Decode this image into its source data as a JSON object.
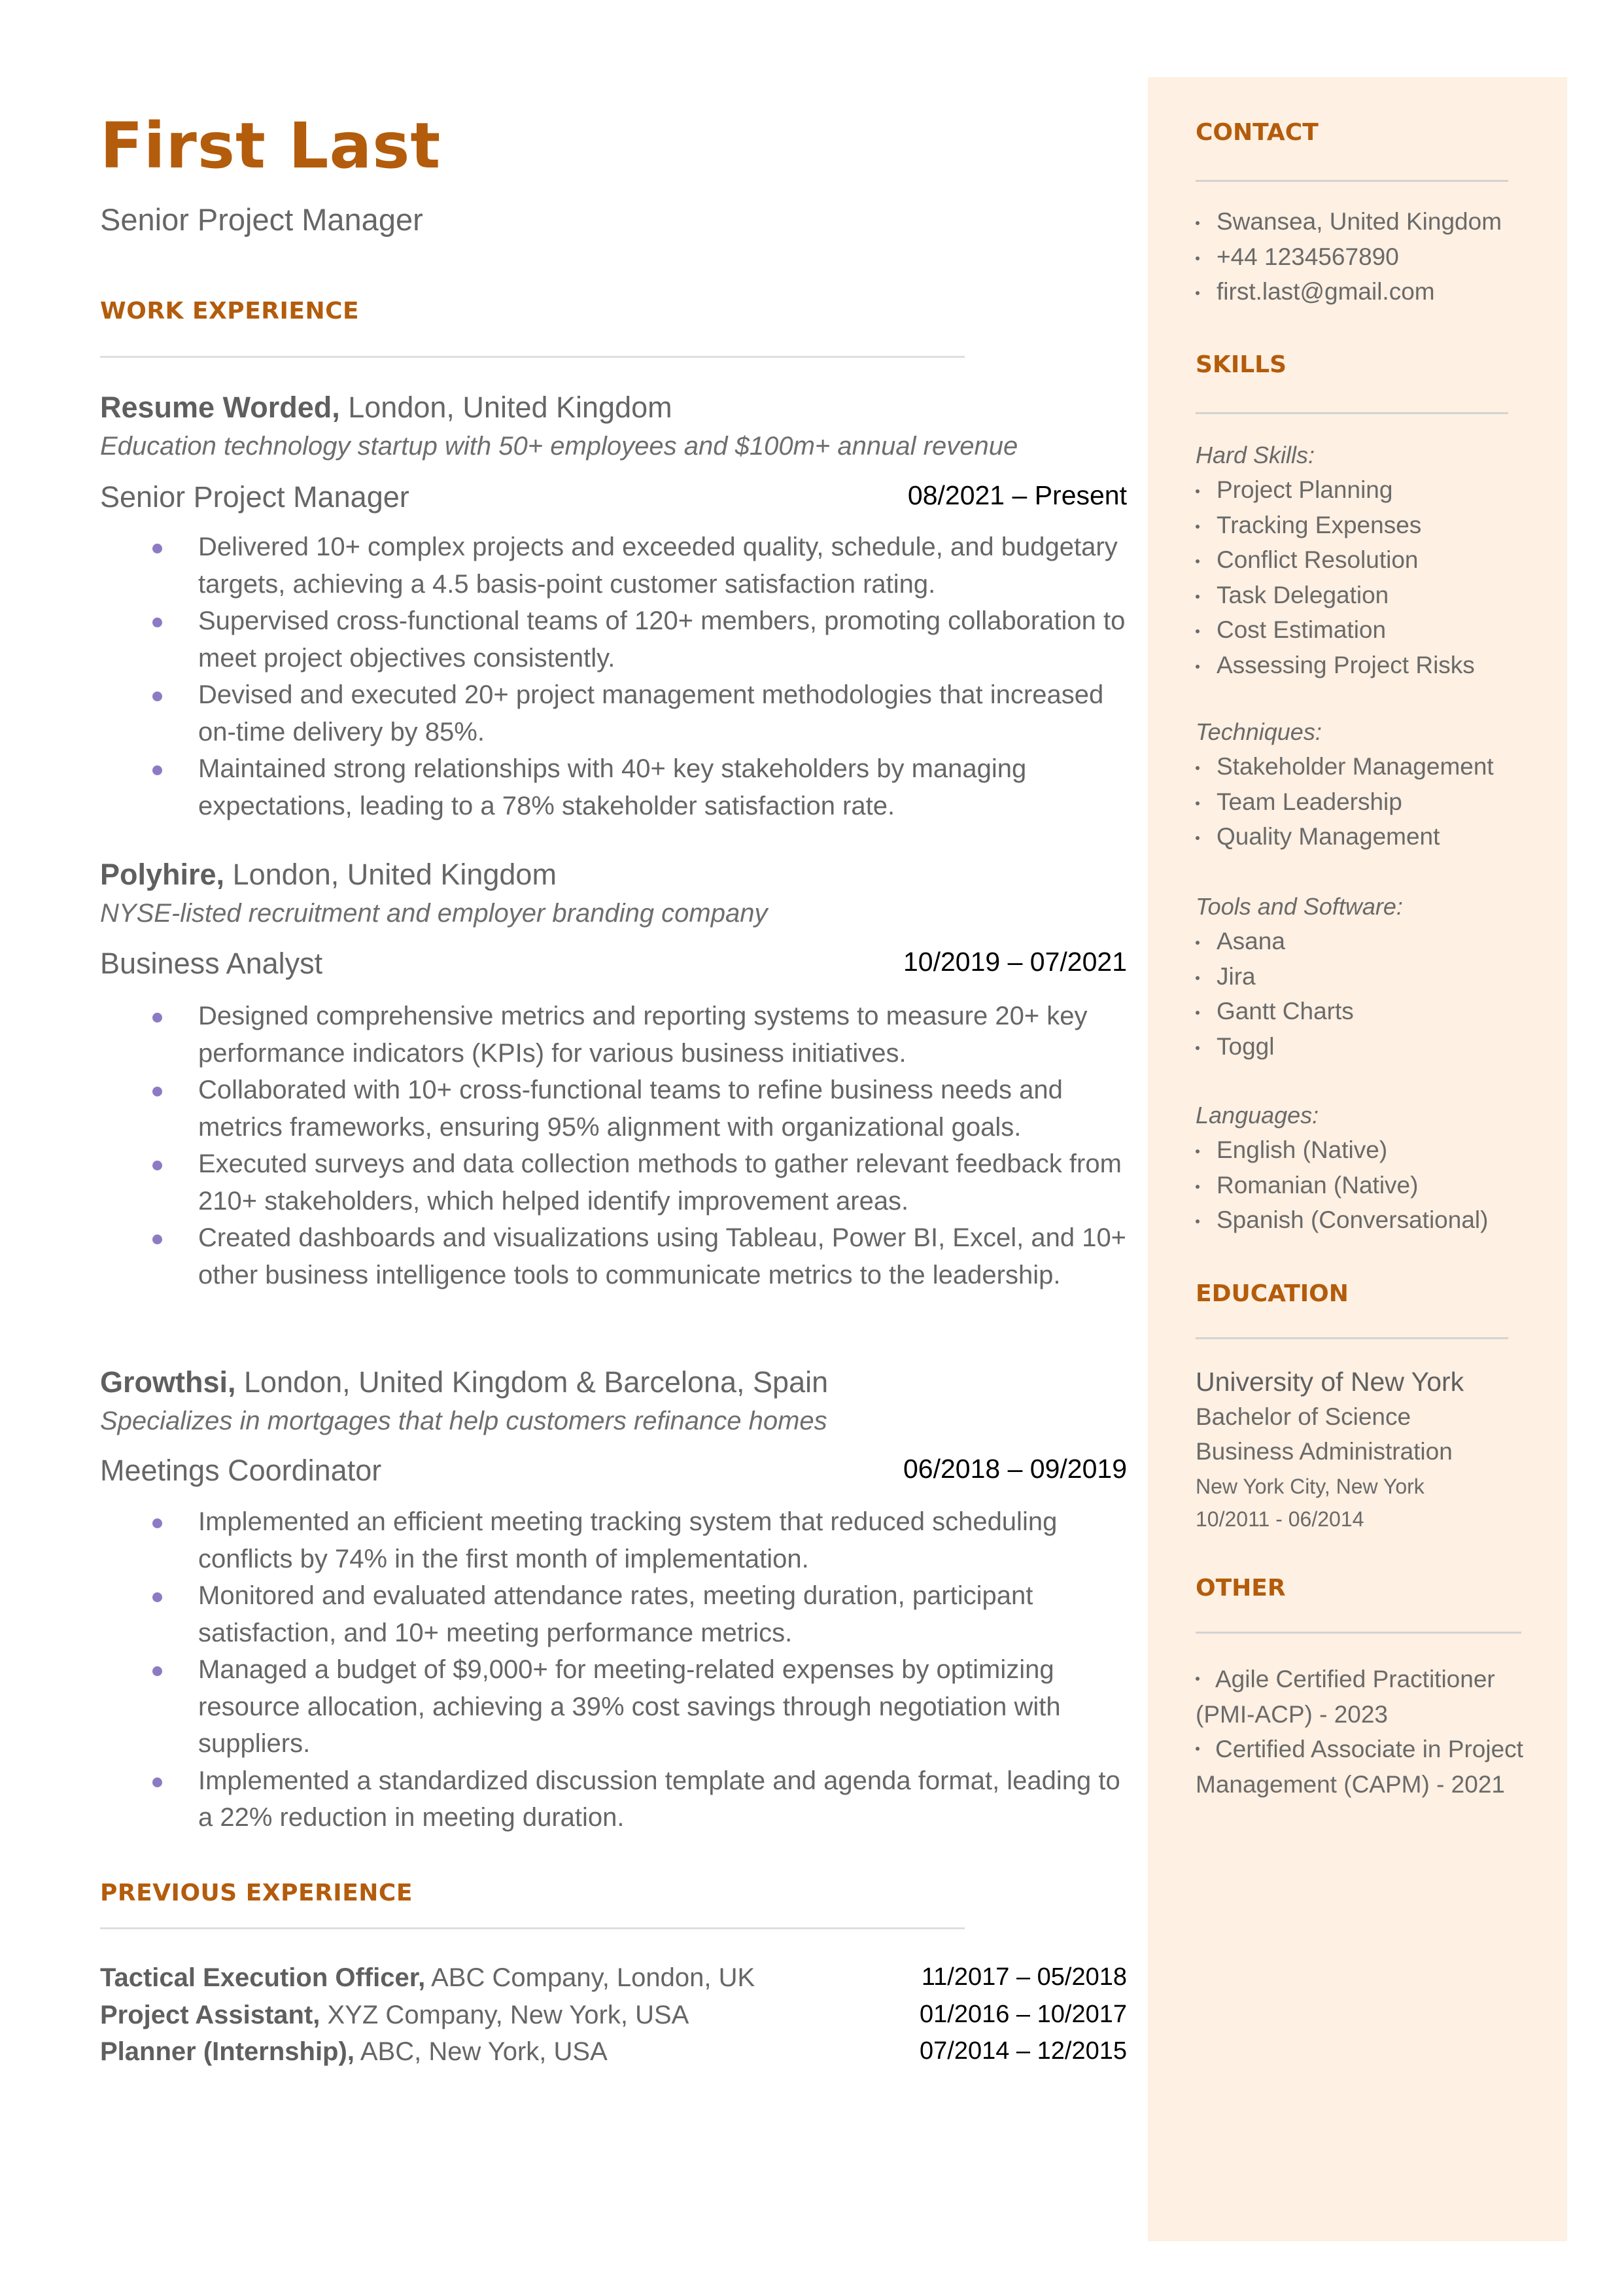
{
  "header": {
    "name": "First Last",
    "title": "Senior Project Manager"
  },
  "colors": {
    "accent": "#b35c0c",
    "bullet": "#8c7bc4",
    "sidebar_bg": "#fef0e2",
    "text": "#666666"
  },
  "work_experience": {
    "heading": "WORK EXPERIENCE",
    "jobs": [
      {
        "company": "Resume Worded,",
        "location": " London, United Kingdom",
        "description": "Education technology startup with 50+ employees and $100m+ annual revenue",
        "role": "Senior Project Manager",
        "dates": "08/2021 – Present",
        "bullets": [
          "Delivered 10+ complex projects and exceeded quality, schedule, and budgetary targets, achieving a 4.5 basis-point customer satisfaction rating.",
          "Supervised cross-functional teams of 120+ members, promoting collaboration to meet project objectives consistently.",
          "Devised and executed 20+ project management methodologies that increased on-time delivery by 85%.",
          "Maintained strong relationships with 40+ key stakeholders by managing expectations, leading to a 78% stakeholder satisfaction rate."
        ]
      },
      {
        "company": "Polyhire,",
        "location": " London, United Kingdom",
        "description": "NYSE-listed recruitment and employer branding company",
        "role": "Business Analyst",
        "dates": "10/2019 – 07/2021",
        "bullets": [
          "Designed comprehensive metrics and reporting systems to measure 20+ key performance indicators (KPIs) for various business initiatives.",
          "Collaborated with 10+ cross-functional teams to refine business needs and metrics frameworks, ensuring 95% alignment with organizational goals.",
          "Executed surveys and data collection methods to gather relevant feedback from 210+ stakeholders, which helped identify improvement areas.",
          "Created dashboards and visualizations using Tableau, Power BI, Excel, and 10+ other business intelligence tools to communicate metrics to the leadership."
        ]
      },
      {
        "company": "Growthsi,",
        "location": " London, United Kingdom & Barcelona, Spain",
        "description": "Specializes in mortgages that help customers refinance homes",
        "role": "Meetings Coordinator",
        "dates": "06/2018 – 09/2019",
        "bullets": [
          "Implemented an efficient meeting tracking system that reduced scheduling conflicts by 74% in the first month of implementation.",
          "Monitored and evaluated attendance rates, meeting duration, participant satisfaction, and 10+ meeting performance metrics.",
          "Managed a budget of $9,000+ for meeting-related expenses by optimizing resource allocation, achieving a 39% cost savings through negotiation with suppliers.",
          "Implemented a standardized discussion template and agenda format, leading to a 22% reduction in meeting duration."
        ]
      }
    ]
  },
  "previous_experience": {
    "heading": "PREVIOUS EXPERIENCE",
    "items": [
      {
        "role": "Tactical Execution Officer,",
        "company": " ABC Company, London, UK",
        "dates": "11/2017 – 05/2018"
      },
      {
        "role": "Project Assistant,",
        "company": " XYZ Company, New York, USA",
        "dates": "01/2016 – 10/2017"
      },
      {
        "role": "Planner (Internship),",
        "company": " ABC, New York, USA",
        "dates": "07/2014 – 12/2015"
      }
    ]
  },
  "sidebar": {
    "contact": {
      "heading": "CONTACT",
      "items": [
        "Swansea, United Kingdom",
        "+44 1234567890",
        "first.last@gmail.com"
      ]
    },
    "skills": {
      "heading": "SKILLS",
      "groups": [
        {
          "label": "Hard Skills:",
          "items": [
            "Project Planning",
            "Tracking Expenses",
            "Conflict Resolution",
            "Task Delegation",
            "Cost Estimation",
            "Assessing Project Risks"
          ]
        },
        {
          "label": "Techniques:",
          "items": [
            "Stakeholder Management",
            "Team Leadership",
            "Quality Management"
          ]
        },
        {
          "label": "Tools and Software:",
          "items": [
            "Asana",
            "Jira",
            "Gantt Charts",
            "Toggl"
          ]
        },
        {
          "label": "Languages:",
          "items": [
            "English (Native)",
            "Romanian (Native)",
            "Spanish (Conversational)"
          ]
        }
      ]
    },
    "education": {
      "heading": "EDUCATION",
      "school": "University of New York",
      "degree": "Bachelor of Science",
      "field": "Business Administration",
      "location": "New York City, New York",
      "dates": "10/2011 - 06/2014"
    },
    "other": {
      "heading": "OTHER",
      "items": [
        "Agile Certified Practitioner (PMI-ACP) - 2023",
        "Certified Associate in Project Management (CAPM) - 2021"
      ]
    }
  }
}
